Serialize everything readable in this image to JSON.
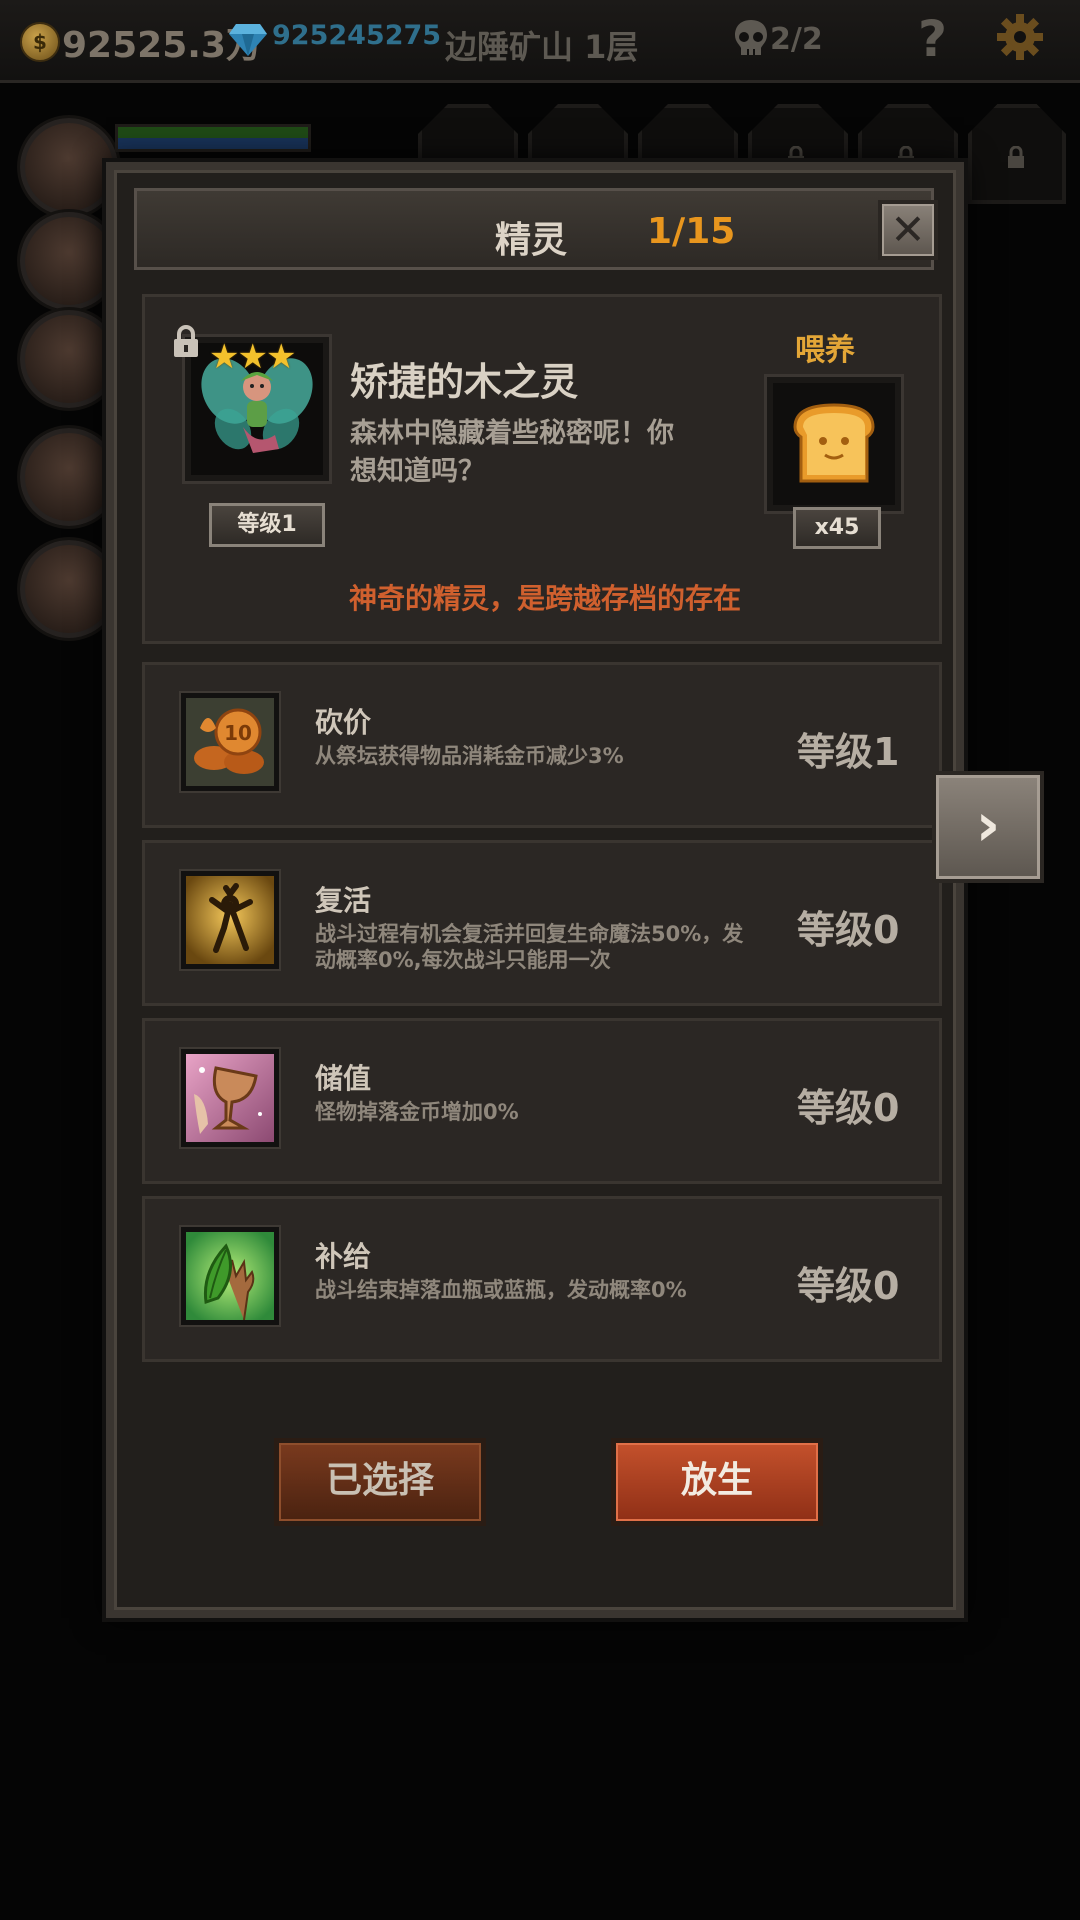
{
  "hud": {
    "coin_icon_label": "$",
    "coins": "92525.3万",
    "gems": "925245275",
    "location": "边陲矿山 1层",
    "kills": "2/2",
    "help": "?"
  },
  "dialog": {
    "title": "精灵",
    "count": "1/15",
    "close_label": "✕",
    "next_label": "›"
  },
  "spirit": {
    "stars": "★★★",
    "name": "矫捷的木之灵",
    "description": "森林中隐藏着些秘密呢！你想知道吗？",
    "level": "等级1",
    "feed_label": "喂养",
    "feed_count": "x45",
    "note": "神奇的精灵，是跨越存档的存在"
  },
  "skills": [
    {
      "name": "砍价",
      "description": "从祭坛获得物品消耗金币减少3%",
      "level": "等级1",
      "icon": "coins-icon"
    },
    {
      "name": "复活",
      "description": "战斗过程有机会复活并回复生命魔法50%，发动概率0%,每次战斗只能用一次",
      "level": "等级0",
      "icon": "revive-icon"
    },
    {
      "name": "储值",
      "description": "怪物掉落金币增加0%",
      "level": "等级0",
      "icon": "goblet-icon"
    },
    {
      "name": "补给",
      "description": "战斗结束掉落血瓶或蓝瓶，发动概率0%",
      "level": "等级0",
      "icon": "leaf-icon"
    }
  ],
  "buttons": {
    "selected": "已选择",
    "release": "放生"
  },
  "colors": {
    "accent_orange": "#e8961e",
    "note_red": "#d0602e",
    "feed_gold": "#e3a637"
  }
}
